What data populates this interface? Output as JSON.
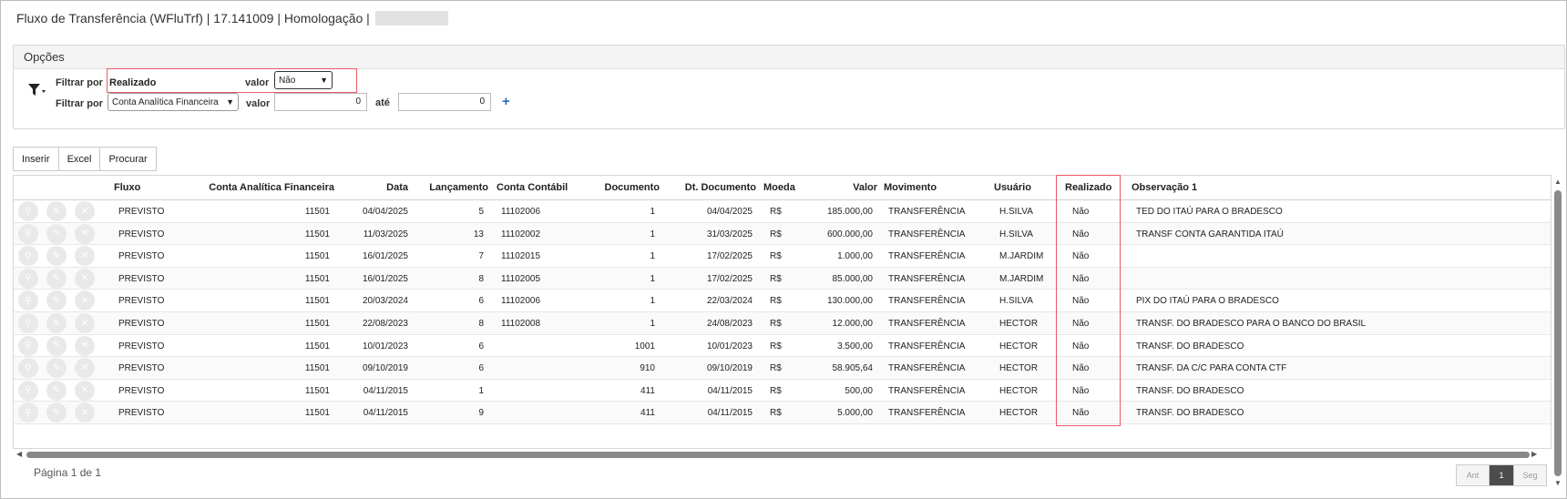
{
  "header": {
    "title": "Fluxo de Transferência (WFluTrf) | 17.141009 | Homologação |"
  },
  "options": {
    "title": "Opções",
    "filter_icon": "funnel-dropdown-icon",
    "filter1": {
      "label": "Filtrar por",
      "field": "Realizado",
      "value_label": "valor",
      "value": "Não"
    },
    "filter2": {
      "label": "Filtrar por",
      "field": "Conta Analítica Financeira",
      "value_label": "valor",
      "value_from": "0",
      "until_label": "até",
      "value_to": "0"
    },
    "add_icon": "plus-icon",
    "add_label": "+"
  },
  "toolbar": {
    "insert": "Inserir",
    "excel": "Excel",
    "search": "Procurar"
  },
  "grid": {
    "row_icons": [
      "view-icon",
      "edit-icon",
      "delete-icon"
    ],
    "columns": [
      "Fluxo",
      "Conta Analítica Financeira",
      "Data",
      "Lançamento",
      "Conta Contábil",
      "Documento",
      "Dt. Documento",
      "Moeda",
      "Valor",
      "Movimento",
      "Usuário",
      "Realizado",
      "Observação 1"
    ],
    "rows": [
      [
        "PREVISTO",
        "11501",
        "04/04/2025",
        "5",
        "11102006",
        "1",
        "04/04/2025",
        "R$",
        "185.000,00",
        "TRANSFERÊNCIA",
        "H.SILVA",
        "Não",
        "TED DO ITAÚ PARA O BRADESCO"
      ],
      [
        "PREVISTO",
        "11501",
        "11/03/2025",
        "13",
        "11102002",
        "1",
        "31/03/2025",
        "R$",
        "600.000,00",
        "TRANSFERÊNCIA",
        "H.SILVA",
        "Não",
        "TRANSF CONTA GARANTIDA ITAÚ"
      ],
      [
        "PREVISTO",
        "11501",
        "16/01/2025",
        "7",
        "11102015",
        "1",
        "17/02/2025",
        "R$",
        "1.000,00",
        "TRANSFERÊNCIA",
        "M.JARDIM",
        "Não",
        ""
      ],
      [
        "PREVISTO",
        "11501",
        "16/01/2025",
        "8",
        "11102005",
        "1",
        "17/02/2025",
        "R$",
        "85.000,00",
        "TRANSFERÊNCIA",
        "M.JARDIM",
        "Não",
        ""
      ],
      [
        "PREVISTO",
        "11501",
        "20/03/2024",
        "6",
        "11102006",
        "1",
        "22/03/2024",
        "R$",
        "130.000,00",
        "TRANSFERÊNCIA",
        "H.SILVA",
        "Não",
        "PIX DO ITAÚ PARA O BRADESCO"
      ],
      [
        "PREVISTO",
        "11501",
        "22/08/2023",
        "8",
        "11102008",
        "1",
        "24/08/2023",
        "R$",
        "12.000,00",
        "TRANSFERÊNCIA",
        "HECTOR",
        "Não",
        "TRANSF. DO BRADESCO PARA O BANCO DO BRASIL"
      ],
      [
        "PREVISTO",
        "11501",
        "10/01/2023",
        "6",
        "",
        "1001",
        "10/01/2023",
        "R$",
        "3.500,00",
        "TRANSFERÊNCIA",
        "HECTOR",
        "Não",
        "TRANSF. DO BRADESCO"
      ],
      [
        "PREVISTO",
        "11501",
        "09/10/2019",
        "6",
        "",
        "910",
        "09/10/2019",
        "R$",
        "58.905,64",
        "TRANSFERÊNCIA",
        "HECTOR",
        "Não",
        "TRANSF. DA C/C PARA CONTA CTF"
      ],
      [
        "PREVISTO",
        "11501",
        "04/11/2015",
        "1",
        "",
        "411",
        "04/11/2015",
        "R$",
        "500,00",
        "TRANSFERÊNCIA",
        "HECTOR",
        "Não",
        "TRANSF. DO BRADESCO"
      ],
      [
        "PREVISTO",
        "11501",
        "04/11/2015",
        "9",
        "",
        "411",
        "04/11/2015",
        "R$",
        "5.000,00",
        "TRANSFERÊNCIA",
        "HECTOR",
        "Não",
        "TRANSF. DO BRADESCO"
      ]
    ]
  },
  "footer": {
    "page_info": "Página 1 de 1",
    "prev": "Ant",
    "page": "1",
    "next": "Seg"
  },
  "colors": {
    "highlight": "#ea5a64",
    "link_blue": "#2a6ebb",
    "active_page": "#4c4c4c"
  }
}
